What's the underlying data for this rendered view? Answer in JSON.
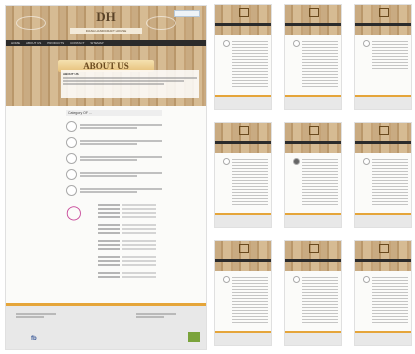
{
  "header": {
    "logo_text": "DH",
    "brand": "DIANA HANDICRAFT HOUSE"
  },
  "nav": {
    "items": [
      "HOME",
      "ABOUT US",
      "PRODUCTS",
      "CONTACT",
      "SITEMAP"
    ]
  },
  "banner": {
    "title": "ABOUT US"
  },
  "intro": {
    "heading": "ABOUT US"
  },
  "categories": {
    "heading": "Category OF ..."
  },
  "footer": {
    "social": "fb"
  },
  "colors": {
    "wood": "#c9ab82",
    "footer_accent": "#e5a53a",
    "dark_nav": "#2b2b2b",
    "shirt": "#c84a9a"
  }
}
